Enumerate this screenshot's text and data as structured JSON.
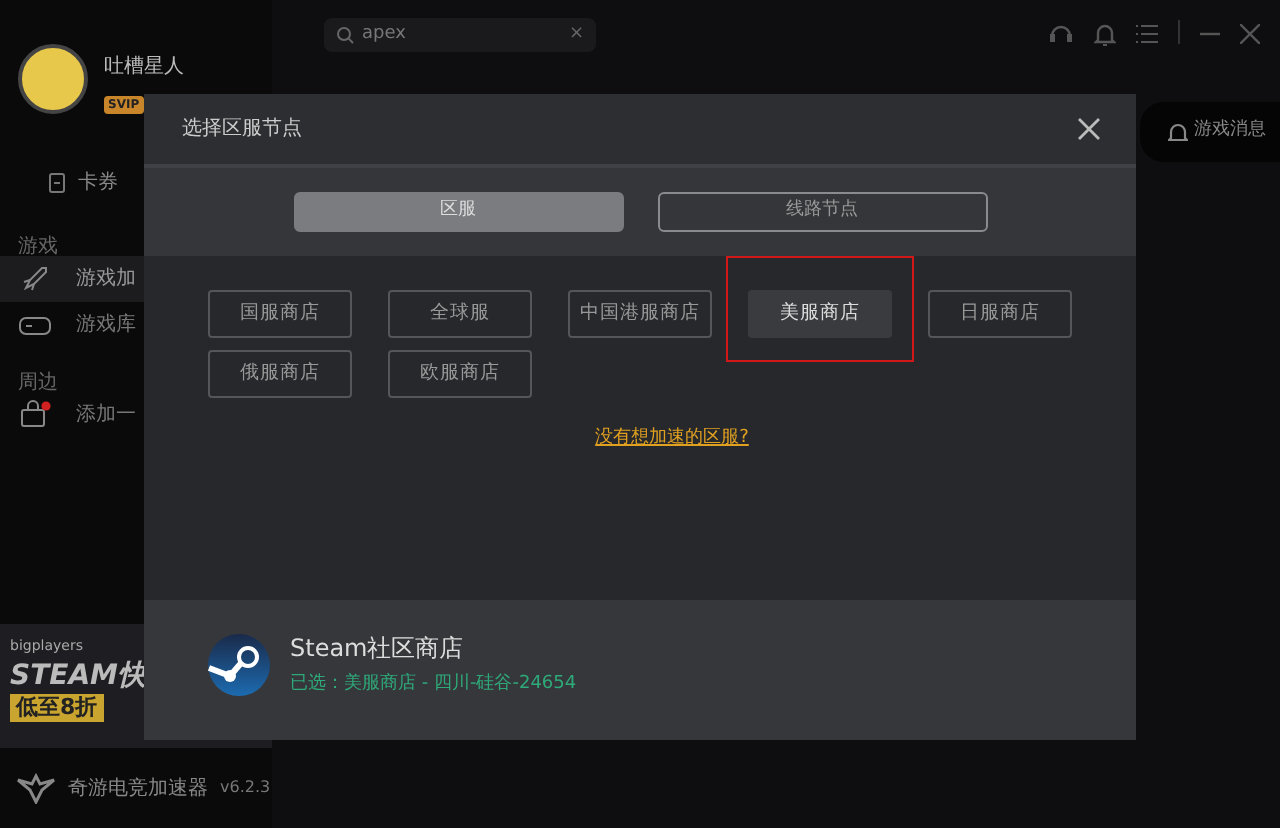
{
  "sidebar": {
    "user": {
      "name": "吐槽星人",
      "badge": "SVIP"
    },
    "coupon": "卡券",
    "items": [
      {
        "kind": "heading",
        "label": "游戏"
      },
      {
        "kind": "item",
        "label": "游戏加",
        "selected": true,
        "dot": false
      },
      {
        "kind": "item",
        "label": "游戏库",
        "selected": false,
        "dot": false
      },
      {
        "kind": "heading",
        "label": "周边"
      },
      {
        "kind": "item",
        "label": "添加一",
        "selected": false,
        "dot": true
      }
    ],
    "banner": {
      "brand": "bigplayers",
      "title": "STEAM快",
      "discount": "低至8折"
    },
    "app": {
      "name": "奇游电竞加速器",
      "version": "v6.2.3"
    }
  },
  "search": {
    "value": "apex",
    "clear": "×"
  },
  "messages_button": "游戏消息",
  "dialog": {
    "title": "选择区服节点",
    "tabs": [
      {
        "label": "区服",
        "selected": true
      },
      {
        "label": "线路节点",
        "selected": false
      }
    ],
    "regions": [
      {
        "label": "国服商店",
        "selected": false,
        "highlighted": false
      },
      {
        "label": "全球服",
        "selected": false,
        "highlighted": false
      },
      {
        "label": "中国港服商店",
        "selected": false,
        "highlighted": false
      },
      {
        "label": "美服商店",
        "selected": true,
        "highlighted": true
      },
      {
        "label": "日服商店",
        "selected": false,
        "highlighted": false
      },
      {
        "label": "俄服商店",
        "selected": false,
        "highlighted": false
      },
      {
        "label": "欧服商店",
        "selected": false,
        "highlighted": false
      }
    ],
    "link": "没有想加速的区服?",
    "store": {
      "name": "Steam社区商店",
      "selection": "已选：美服商店 - 四川-硅谷-24654"
    }
  }
}
